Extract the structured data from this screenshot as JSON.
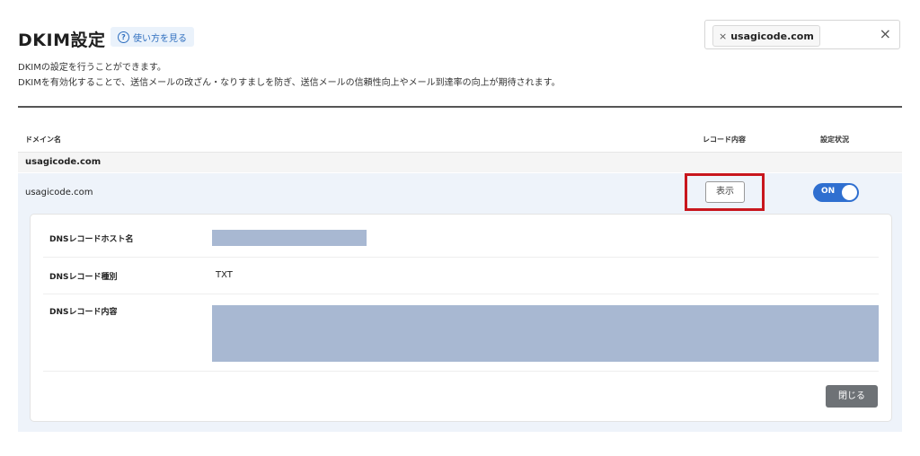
{
  "page": {
    "title": "DKIM設定",
    "help_label": "使い方を見る",
    "help_icon": "question-circle-icon",
    "description_line1": "DKIMの設定を行うことができます。",
    "description_line2": "DKIMを有効化することで、送信メールの改ざん・なりすましを防ぎ、送信メールの信頼性向上やメール到達率の向上が期待されます。"
  },
  "filter": {
    "chip_label": "usagicode.com",
    "chip_remove_icon": "×",
    "clear_icon": "×"
  },
  "table": {
    "headers": {
      "domain": "ドメイン名",
      "record": "レコード内容",
      "status": "設定状況"
    },
    "group_label": "usagicode.com",
    "row": {
      "domain": "usagicode.com",
      "show_button": "表示",
      "toggle_label": "ON",
      "toggle_on": true
    }
  },
  "record_details": {
    "host_label": "DNSレコードホスト名",
    "type_label": "DNSレコード種別",
    "type_value": "TXT",
    "content_label": "DNSレコード内容",
    "close_button": "閉じる"
  },
  "colors": {
    "accent": "#2f6fd0",
    "highlight": "#c8161d",
    "mask": "#a8b8d2",
    "expanded_bg": "#eef3fa"
  }
}
